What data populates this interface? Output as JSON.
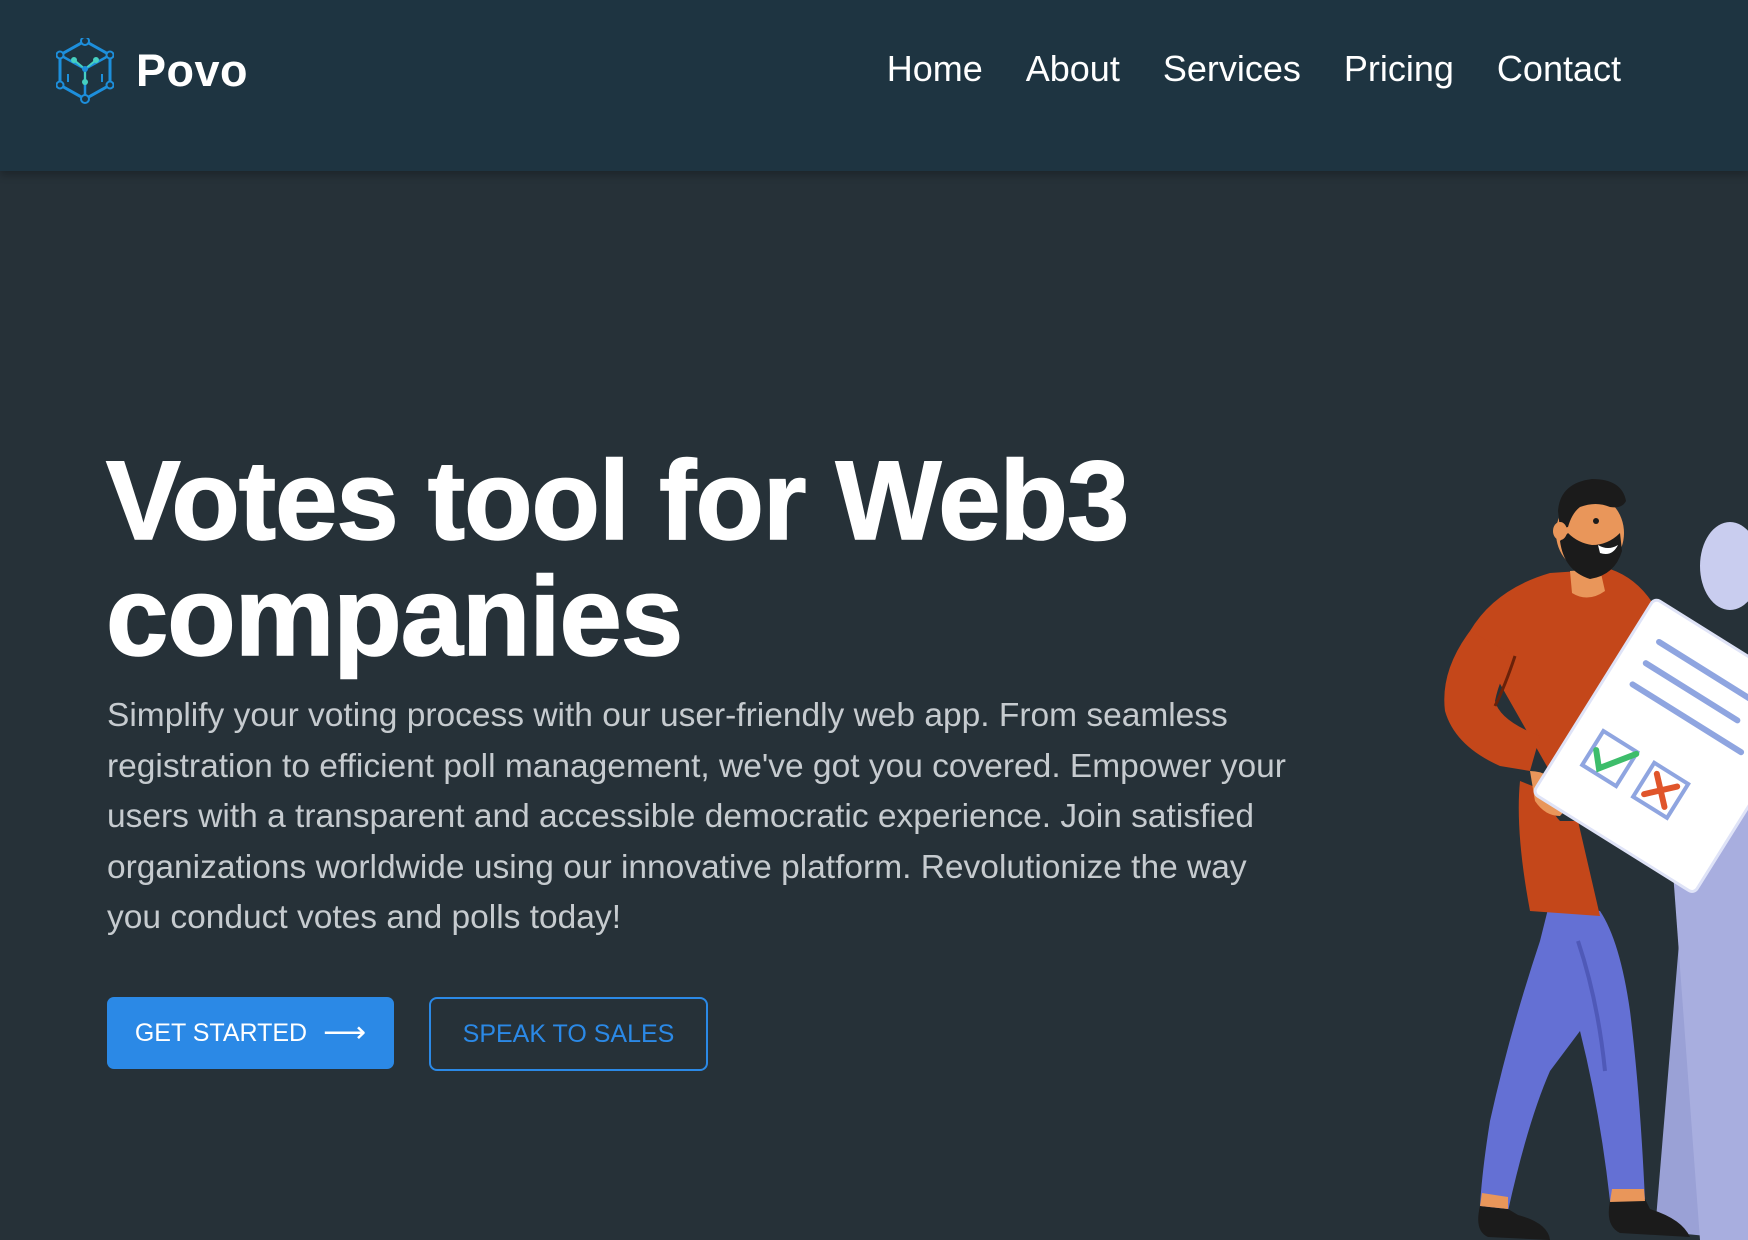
{
  "brand": {
    "name": "Povo",
    "logo_icon": "cube-network-icon"
  },
  "nav": {
    "items": [
      {
        "label": "Home"
      },
      {
        "label": "About"
      },
      {
        "label": "Services"
      },
      {
        "label": "Pricing"
      },
      {
        "label": "Contact"
      }
    ]
  },
  "hero": {
    "title_line1": "Votes tool for Web3",
    "title_line2": "companies",
    "description": "Simplify your voting process with our user-friendly web app. From seamless registration to efficient poll management, we've got you covered. Empower your users with a transparent and accessible democratic experience. Join satisfied organizations worldwide using our innovative platform. Revolutionize the way you conduct votes and polls today!",
    "primary_button": {
      "label": "GET STARTED",
      "icon": "arrow-right-icon",
      "arrow": "⟶"
    },
    "secondary_button": {
      "label": "SPEAK TO SALES"
    },
    "illustration": "person-holding-ballot-illustration"
  },
  "colors": {
    "header_bg": "#1e3441",
    "page_bg": "#263138",
    "accent": "#2b89e6",
    "text": "#ffffff",
    "muted_text": "#c6cbcf",
    "shirt": "#c4471a",
    "pants": "#6470d4"
  }
}
